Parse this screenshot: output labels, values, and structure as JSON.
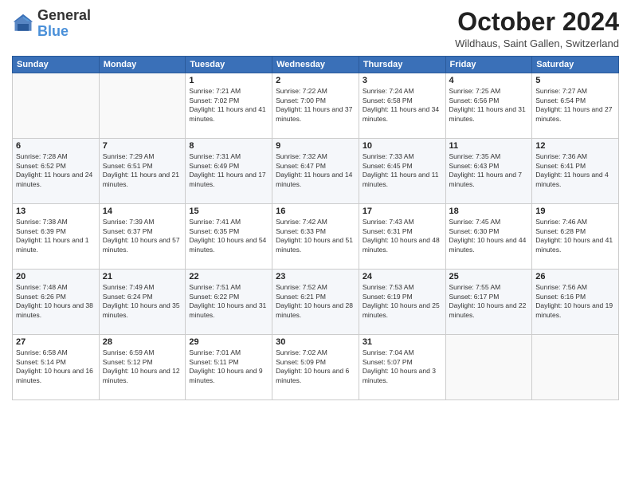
{
  "header": {
    "logo_general": "General",
    "logo_blue": "Blue",
    "month_title": "October 2024",
    "location": "Wildhaus, Saint Gallen, Switzerland"
  },
  "weekdays": [
    "Sunday",
    "Monday",
    "Tuesday",
    "Wednesday",
    "Thursday",
    "Friday",
    "Saturday"
  ],
  "weeks": [
    [
      {
        "day": "",
        "info": ""
      },
      {
        "day": "",
        "info": ""
      },
      {
        "day": "1",
        "info": "Sunrise: 7:21 AM\nSunset: 7:02 PM\nDaylight: 11 hours and 41 minutes."
      },
      {
        "day": "2",
        "info": "Sunrise: 7:22 AM\nSunset: 7:00 PM\nDaylight: 11 hours and 37 minutes."
      },
      {
        "day": "3",
        "info": "Sunrise: 7:24 AM\nSunset: 6:58 PM\nDaylight: 11 hours and 34 minutes."
      },
      {
        "day": "4",
        "info": "Sunrise: 7:25 AM\nSunset: 6:56 PM\nDaylight: 11 hours and 31 minutes."
      },
      {
        "day": "5",
        "info": "Sunrise: 7:27 AM\nSunset: 6:54 PM\nDaylight: 11 hours and 27 minutes."
      }
    ],
    [
      {
        "day": "6",
        "info": "Sunrise: 7:28 AM\nSunset: 6:52 PM\nDaylight: 11 hours and 24 minutes."
      },
      {
        "day": "7",
        "info": "Sunrise: 7:29 AM\nSunset: 6:51 PM\nDaylight: 11 hours and 21 minutes."
      },
      {
        "day": "8",
        "info": "Sunrise: 7:31 AM\nSunset: 6:49 PM\nDaylight: 11 hours and 17 minutes."
      },
      {
        "day": "9",
        "info": "Sunrise: 7:32 AM\nSunset: 6:47 PM\nDaylight: 11 hours and 14 minutes."
      },
      {
        "day": "10",
        "info": "Sunrise: 7:33 AM\nSunset: 6:45 PM\nDaylight: 11 hours and 11 minutes."
      },
      {
        "day": "11",
        "info": "Sunrise: 7:35 AM\nSunset: 6:43 PM\nDaylight: 11 hours and 7 minutes."
      },
      {
        "day": "12",
        "info": "Sunrise: 7:36 AM\nSunset: 6:41 PM\nDaylight: 11 hours and 4 minutes."
      }
    ],
    [
      {
        "day": "13",
        "info": "Sunrise: 7:38 AM\nSunset: 6:39 PM\nDaylight: 11 hours and 1 minute."
      },
      {
        "day": "14",
        "info": "Sunrise: 7:39 AM\nSunset: 6:37 PM\nDaylight: 10 hours and 57 minutes."
      },
      {
        "day": "15",
        "info": "Sunrise: 7:41 AM\nSunset: 6:35 PM\nDaylight: 10 hours and 54 minutes."
      },
      {
        "day": "16",
        "info": "Sunrise: 7:42 AM\nSunset: 6:33 PM\nDaylight: 10 hours and 51 minutes."
      },
      {
        "day": "17",
        "info": "Sunrise: 7:43 AM\nSunset: 6:31 PM\nDaylight: 10 hours and 48 minutes."
      },
      {
        "day": "18",
        "info": "Sunrise: 7:45 AM\nSunset: 6:30 PM\nDaylight: 10 hours and 44 minutes."
      },
      {
        "day": "19",
        "info": "Sunrise: 7:46 AM\nSunset: 6:28 PM\nDaylight: 10 hours and 41 minutes."
      }
    ],
    [
      {
        "day": "20",
        "info": "Sunrise: 7:48 AM\nSunset: 6:26 PM\nDaylight: 10 hours and 38 minutes."
      },
      {
        "day": "21",
        "info": "Sunrise: 7:49 AM\nSunset: 6:24 PM\nDaylight: 10 hours and 35 minutes."
      },
      {
        "day": "22",
        "info": "Sunrise: 7:51 AM\nSunset: 6:22 PM\nDaylight: 10 hours and 31 minutes."
      },
      {
        "day": "23",
        "info": "Sunrise: 7:52 AM\nSunset: 6:21 PM\nDaylight: 10 hours and 28 minutes."
      },
      {
        "day": "24",
        "info": "Sunrise: 7:53 AM\nSunset: 6:19 PM\nDaylight: 10 hours and 25 minutes."
      },
      {
        "day": "25",
        "info": "Sunrise: 7:55 AM\nSunset: 6:17 PM\nDaylight: 10 hours and 22 minutes."
      },
      {
        "day": "26",
        "info": "Sunrise: 7:56 AM\nSunset: 6:16 PM\nDaylight: 10 hours and 19 minutes."
      }
    ],
    [
      {
        "day": "27",
        "info": "Sunrise: 6:58 AM\nSunset: 5:14 PM\nDaylight: 10 hours and 16 minutes."
      },
      {
        "day": "28",
        "info": "Sunrise: 6:59 AM\nSunset: 5:12 PM\nDaylight: 10 hours and 12 minutes."
      },
      {
        "day": "29",
        "info": "Sunrise: 7:01 AM\nSunset: 5:11 PM\nDaylight: 10 hours and 9 minutes."
      },
      {
        "day": "30",
        "info": "Sunrise: 7:02 AM\nSunset: 5:09 PM\nDaylight: 10 hours and 6 minutes."
      },
      {
        "day": "31",
        "info": "Sunrise: 7:04 AM\nSunset: 5:07 PM\nDaylight: 10 hours and 3 minutes."
      },
      {
        "day": "",
        "info": ""
      },
      {
        "day": "",
        "info": ""
      }
    ]
  ]
}
